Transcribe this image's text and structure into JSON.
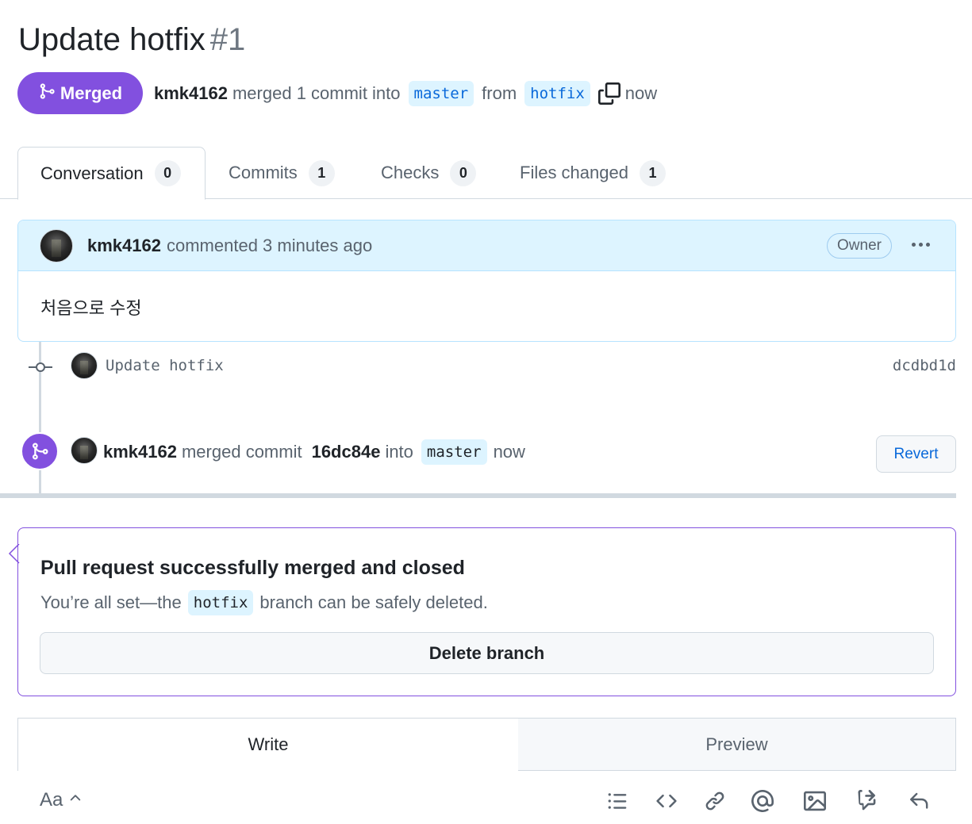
{
  "pr": {
    "title": "Update hotfix",
    "number": "#1",
    "state": "Merged",
    "author": "kmk4162",
    "merged_text": "merged 1 commit into",
    "base_branch": "master",
    "from_text": "from",
    "head_branch": "hotfix",
    "time": "now"
  },
  "tabs": [
    {
      "label": "Conversation",
      "count": "0"
    },
    {
      "label": "Commits",
      "count": "1"
    },
    {
      "label": "Checks",
      "count": "0"
    },
    {
      "label": "Files changed",
      "count": "1"
    }
  ],
  "comment": {
    "author": "kmk4162",
    "action": "commented 3 minutes ago",
    "role": "Owner",
    "body": "처음으로 수정"
  },
  "commit": {
    "message": "Update hotfix",
    "sha": "dcdbd1d"
  },
  "merge_event": {
    "author": "kmk4162",
    "text1": "merged commit",
    "sha": "16dc84e",
    "text2": "into",
    "branch": "master",
    "time": "now",
    "revert_label": "Revert"
  },
  "merged_box": {
    "title": "Pull request successfully merged and closed",
    "sub_before": "You’re all set—the",
    "branch": "hotfix",
    "sub_after": "branch can be safely deleted.",
    "delete_label": "Delete branch"
  },
  "editor": {
    "write_label": "Write",
    "preview_label": "Preview",
    "format_label": "Aa"
  },
  "icons": [
    "git-merge-icon",
    "copy-icon",
    "kebab-icon",
    "git-commit-icon",
    "chevron-up-icon",
    "list-icon",
    "code-icon",
    "link-icon",
    "mention-icon",
    "image-icon",
    "cross-reference-icon",
    "reply-icon"
  ],
  "colors": {
    "merged_purple": "#8250df",
    "link_blue": "#0969da",
    "branch_bg": "#ddf4ff"
  }
}
